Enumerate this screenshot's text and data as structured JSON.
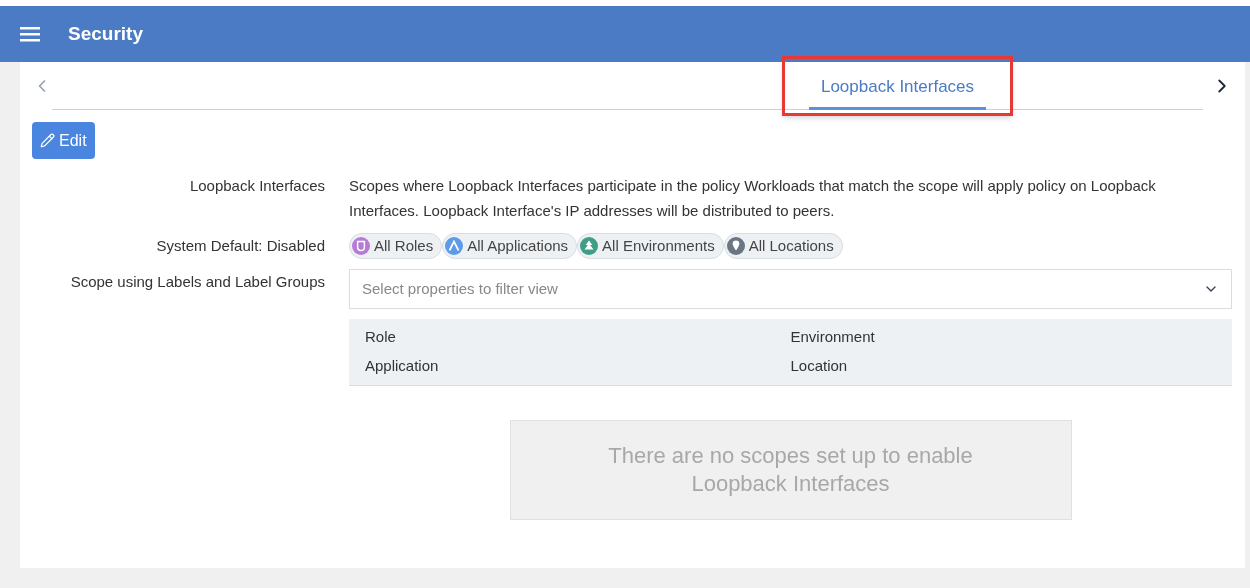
{
  "header": {
    "title": "Security"
  },
  "tabs": [
    {
      "label": "Loopback Interfaces",
      "selected": true,
      "highlighted": true
    }
  ],
  "edit_button": {
    "label": "Edit"
  },
  "fields": [
    {
      "label": "Loopback Interfaces",
      "kind": "text",
      "text": "Scopes where Loopback Interfaces participate in the policy Workloads that match the scope will apply policy on Loopback Interfaces. Loopback Interface's IP addresses will be distributed to peers."
    },
    {
      "label": "System Default: Disabled",
      "kind": "pills",
      "pills": [
        {
          "label": "All Roles",
          "kind": "role",
          "color": "#b57bd6"
        },
        {
          "label": "All Applications",
          "kind": "application",
          "color": "#5b9be8"
        },
        {
          "label": "All Environments",
          "kind": "environment",
          "color": "#3f9e86"
        },
        {
          "label": "All Locations",
          "kind": "location",
          "color": "#6b7684"
        }
      ]
    },
    {
      "label": "Scope using Labels and Label Groups",
      "kind": "scope",
      "placeholder": "Select properties to filter view",
      "legend": [
        [
          "Role",
          "Environment"
        ],
        [
          "Application",
          "Location"
        ]
      ],
      "empty_message": "There are no scopes set up to enable Loopback Interfaces"
    }
  ]
}
